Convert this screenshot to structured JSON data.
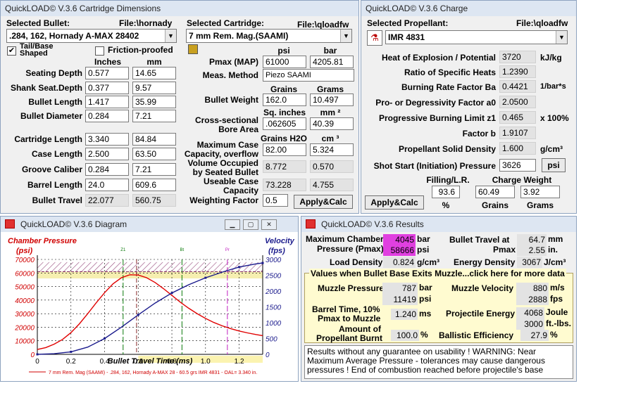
{
  "cartridge_window": {
    "title": "QuickLOAD© V.3.6 Cartridge Dimensions",
    "selected_bullet_label": "Selected Bullet:",
    "bullet_file": "File:\\hornady",
    "bullet_value": ".284, 162, Hornady A-MAX 28402",
    "selected_cartridge_label": "Selected Cartridge:",
    "cartridge_file": "File:\\qloadfw",
    "cartridge_value": "7 mm Rem. Mag.(SAAMI)",
    "tail_base_label": "Tail/Base Shaped",
    "tail_base_checked": "✔",
    "friction_label": "Friction-proofed",
    "col_inches": "Inches",
    "col_mm": "mm",
    "rows": [
      {
        "label": "Seating Depth",
        "in": "0.577",
        "mm": "14.65"
      },
      {
        "label": "Shank Seat.Depth",
        "in": "0.377",
        "mm": "9.57"
      },
      {
        "label": "Bullet Length",
        "in": "1.417",
        "mm": "35.99"
      },
      {
        "label": "Bullet Diameter",
        "in": "0.284",
        "mm": "7.21"
      },
      {
        "label": "Cartridge Length",
        "in": "3.340",
        "mm": "84.84"
      },
      {
        "label": "Case Length",
        "in": "2.500",
        "mm": "63.50"
      },
      {
        "label": "Groove Caliber",
        "in": "0.284",
        "mm": "7.21"
      },
      {
        "label": "Barrel Length",
        "in": "24.0",
        "mm": "609.6"
      },
      {
        "label": "Bullet Travel",
        "in": "22.077",
        "mm": "560.75"
      }
    ],
    "psi_hdr": "psi",
    "bar_hdr": "bar",
    "pmax_label": "Pmax (MAP)",
    "pmax_psi": "61000",
    "pmax_bar": "4205.81",
    "meas_label": "Meas. Method",
    "meas_value": "Piezo SAAMI",
    "grains_hdr": "Grains",
    "grams_hdr": "Grams",
    "bw_label": "Bullet Weight",
    "bw_grains": "162.0",
    "bw_grams": "10.497",
    "sq_in_hdr": "Sq. inches",
    "mm2_hdr": "mm ²",
    "cs_label1": "Cross-sectional",
    "cs_label2": "Bore Area",
    "cs_in": ".062605",
    "cs_mm": "40.39",
    "h2o_hdr": "Grains H2O",
    "cm3_hdr": "cm ³",
    "mcc_label1": "Maximum Case",
    "mcc_label2": "Capacity, overflow",
    "mcc_gr": "82.00",
    "mcc_cm": "5.324",
    "vol_label1": "Volume Occupied",
    "vol_label2": "by Seated Bullet",
    "vol_gr": "8.772",
    "vol_cm": "0.570",
    "ucc_label1": "Useable Case",
    "ucc_label2": "Capacity",
    "ucc_gr": "73.228",
    "ucc_cm": "4.755",
    "wf_label": "Weighting Factor",
    "wf_value": "0.5",
    "apply_label": "Apply&Calc"
  },
  "charge_window": {
    "title": "QuickLOAD© V.3.6 Charge",
    "selected_propellant_label": "Selected Propellant:",
    "file": "File:\\qloadfw",
    "propellant_value": "IMR 4831",
    "rows": [
      {
        "label": "Heat of Explosion / Potential",
        "value": "3720",
        "unit": "kJ/kg"
      },
      {
        "label": "Ratio of Specific Heats",
        "value": "1.2390",
        "unit": ""
      },
      {
        "label": "Burning Rate Factor  Ba",
        "value": "0.4421",
        "unit": "1/bar*s"
      },
      {
        "label": "Pro- or Degressivity Factor  a0",
        "value": "2.0500",
        "unit": ""
      },
      {
        "label": "Progressive Burning Limit z1",
        "value": "0.465",
        "unit": "x 100%"
      },
      {
        "label": "Factor  b",
        "value": "1.9107",
        "unit": ""
      },
      {
        "label": "Propellant Solid Density",
        "value": "1.600",
        "unit": "g/cm³"
      },
      {
        "label": "Shot Start (Initiation) Pressure",
        "value": "3626",
        "unit": ""
      }
    ],
    "psi_btn": "psi",
    "filling_hdr": "Filling/L.R.",
    "charge_weight_hdr": "Charge Weight",
    "filling_value": "93.6",
    "charge_grains": "60.49",
    "charge_grams": "3.92",
    "pct_label": "%",
    "grains_label": "Grains",
    "grams_label": "Grams",
    "apply_label": "Apply&Calc"
  },
  "diagram_window": {
    "title": "QuickLOAD© V.3.6 Diagram",
    "chamber_pressure_label": "Chamber Pressure",
    "psi_label": "(psi)",
    "velocity_label": "Velocity",
    "fps_label": "(fps)",
    "xlabel": "Bullet Travel Time (ms)",
    "legend": "7 mm Rem. Mag (SAAMI) - .284, 162, Hornady A-MAX 28 - 60.5 grs IMR 4831 - OAL= 3.340 in."
  },
  "chart_data": {
    "type": "line",
    "x_ticks": [
      "0",
      "0.2",
      "0.4",
      "0.6",
      "0.8",
      "1.0",
      "1.2"
    ],
    "y_left_ticks": [
      "0",
      "10000",
      "20000",
      "30000",
      "40000",
      "50000",
      "60000",
      "70000"
    ],
    "y_right_ticks": [
      "0",
      "500",
      "1000",
      "1500",
      "2000",
      "2500",
      "3000"
    ],
    "xlim": [
      0,
      1.34
    ],
    "ylim_left": [
      0,
      70000
    ],
    "ylim_right": [
      0,
      3000
    ],
    "series": [
      {
        "name": "Chamber Pressure",
        "axis": "left",
        "color": "#e00000",
        "x": [
          0,
          0.05,
          0.1,
          0.15,
          0.2,
          0.25,
          0.3,
          0.35,
          0.4,
          0.45,
          0.5,
          0.55,
          0.6,
          0.65,
          0.7,
          0.75,
          0.8,
          0.85,
          0.9,
          0.95,
          1.0,
          1.05,
          1.1,
          1.15,
          1.2,
          1.25,
          1.3,
          1.34
        ],
        "y": [
          3600,
          5000,
          7500,
          11000,
          16000,
          22500,
          30000,
          38000,
          45500,
          52000,
          56500,
          58700,
          58500,
          56500,
          53000,
          48500,
          43500,
          38500,
          34000,
          30000,
          26500,
          23500,
          21000,
          19000,
          17200,
          15800,
          14600,
          13800
        ]
      },
      {
        "name": "Velocity",
        "axis": "right",
        "color": "#1a1a8c",
        "x": [
          0,
          0.1,
          0.2,
          0.3,
          0.4,
          0.5,
          0.6,
          0.7,
          0.8,
          0.9,
          1.0,
          1.1,
          1.2,
          1.3,
          1.34
        ],
        "y": [
          0,
          20,
          80,
          230,
          500,
          860,
          1250,
          1620,
          1940,
          2200,
          2420,
          2600,
          2760,
          2860,
          2888
        ]
      }
    ],
    "markers": [
      "Z1",
      "Bt",
      "Pr"
    ]
  },
  "results_window": {
    "title": "QuickLOAD© V.3.6 Results",
    "max_chamber_label1": "Maximum Chamber",
    "max_chamber_label2": "Pressure (Pmax)",
    "pmax_bar": "4045",
    "pmax_psi": "58666",
    "bar_unit": "bar",
    "psi_unit": "psi",
    "bt_label1": "Bullet Travel at",
    "bt_label2": "Pmax",
    "bt_mm": "64.7",
    "bt_in": "2.55",
    "mm_unit": "mm",
    "in_unit": "in.",
    "load_density_label": "Load Density",
    "load_density": "0.824",
    "ld_unit": "g/cm³",
    "energy_density_label": "Energy Density",
    "energy_density": "3067",
    "ed_unit": "J/cm³",
    "muzzle_header": "Values when Bullet Base Exits Muzzle...click here for more data",
    "muzzle_pressure_label": "Muzzle Pressure",
    "muzzle_pressure_bar": "787",
    "muzzle_pressure_psi": "11419",
    "muzzle_velocity_label": "Muzzle Velocity",
    "muzzle_velocity_ms": "880",
    "muzzle_velocity_fps": "2888",
    "ms_unit": "m/s",
    "fps_unit": "fps",
    "barrel_time_label1": "Barrel Time, 10%",
    "barrel_time_label2": "Pmax to Muzzle",
    "barrel_time": "1.240",
    "ms2_unit": "ms",
    "proj_energy_label": "Projectile Energy",
    "proj_energy_j": "4068",
    "proj_energy_ftlb": "3000",
    "joule_unit": "Joule",
    "ftlbs_unit": "ft.-lbs.",
    "amount_burnt_label1": "Amount of",
    "amount_burnt_label2": "Propellant Burnt",
    "amount_burnt": "100.0",
    "pct_unit": "%",
    "ballistic_eff_label": "Ballistic Efficiency",
    "ballistic_eff": "27.9",
    "message": "Results without any guarantee on usability !  WARNING: Near Maximum Average Pressure - tolerances may cause dangerous pressures !  End of combustion reached before projectile's base"
  }
}
